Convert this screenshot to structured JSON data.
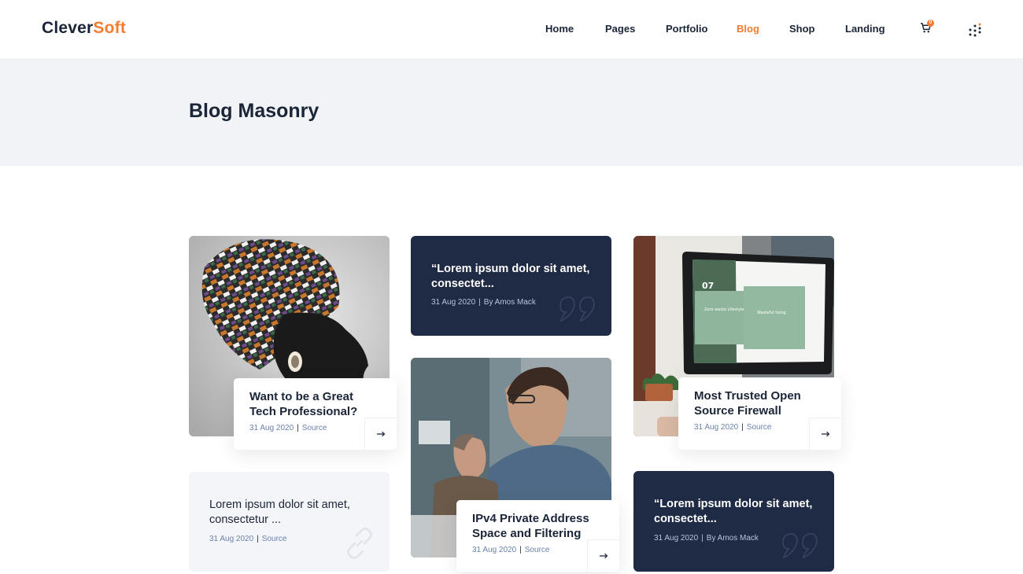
{
  "header": {
    "logo_part1": "Clever",
    "logo_part2": "Soft",
    "nav": [
      "Home",
      "Pages",
      "Portfolio",
      "Blog",
      "Shop",
      "Landing"
    ],
    "active_nav": "Blog",
    "cart_count": "0",
    "accent_color": "#f47c30"
  },
  "hero": {
    "title": "Blog Masonry"
  },
  "posts": {
    "p1": {
      "title": "Want to be a Great Tech Professional?",
      "date": "31 Aug 2020",
      "source": "Source"
    },
    "p2": {
      "quote": "“Lorem ipsum dolor sit amet, consectet...",
      "date": "31 Aug 2020",
      "author": "By Amos Mack"
    },
    "p3": {
      "title": "Most Trusted Open Source Firewall",
      "date": "31 Aug 2020",
      "source": "Source"
    },
    "p4": {
      "title": "IPv4 Private Address Space and Filtering",
      "date": "31 Aug 2020",
      "source": "Source"
    },
    "p5": {
      "text": "Lorem ipsum dolor sit amet, consectetur ...",
      "date": "31 Aug 2020",
      "source": "Source"
    },
    "p6": {
      "quote": "“Lorem ipsum dolor sit amet, consectet...",
      "date": "31 Aug 2020",
      "author": "By Amos Mack"
    },
    "p3_screen_number": "07",
    "p3_screen_label_1": "Zero waste Lifestyle",
    "p3_screen_label_2": "Wasteful living"
  },
  "icons": [
    "cart-icon",
    "menu-dots-icon",
    "arrow-right-icon",
    "quote-icon",
    "link-icon"
  ]
}
